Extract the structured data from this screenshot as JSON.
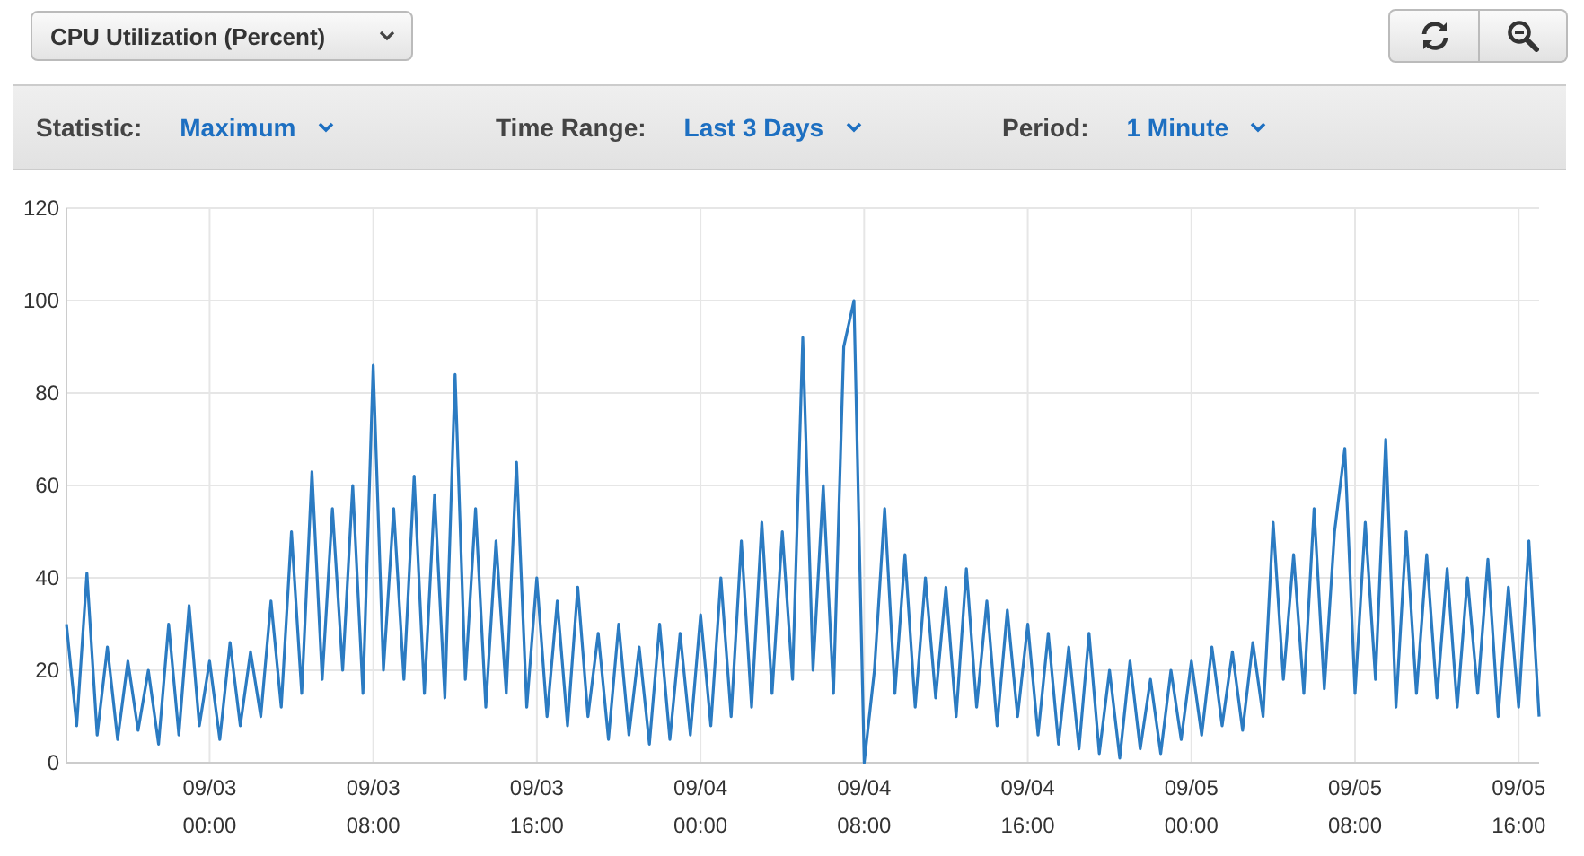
{
  "metric_select": {
    "value": "CPU Utilization (Percent)"
  },
  "toolbar": [
    {
      "label": "Statistic:",
      "value": "Maximum"
    },
    {
      "label": "Time Range:",
      "value": "Last 3 Days"
    },
    {
      "label": "Period:",
      "value": "1 Minute"
    }
  ],
  "chart": {
    "chart_data": {
      "type": "line",
      "grid": true,
      "ylim": [
        0,
        120
      ],
      "yticks": [
        0,
        20,
        40,
        60,
        80,
        100,
        120
      ],
      "categories": [
        null,
        null,
        null,
        null,
        null,
        null,
        null,
        null,
        null,
        null,
        null,
        null,
        null,
        null,
        "09/03 00:00",
        null,
        null,
        null,
        null,
        null,
        null,
        null,
        null,
        null,
        null,
        null,
        null,
        null,
        null,
        null,
        "09/03 08:00",
        null,
        null,
        null,
        null,
        null,
        null,
        null,
        null,
        null,
        null,
        null,
        null,
        null,
        null,
        null,
        "09/03 16:00",
        null,
        null,
        null,
        null,
        null,
        null,
        null,
        null,
        null,
        null,
        null,
        null,
        null,
        null,
        null,
        "09/04 00:00",
        null,
        null,
        null,
        null,
        null,
        null,
        null,
        null,
        null,
        null,
        null,
        null,
        null,
        null,
        null,
        "09/04 08:00",
        null,
        null,
        null,
        null,
        null,
        null,
        null,
        null,
        null,
        null,
        null,
        null,
        null,
        null,
        null,
        "09/04 16:00",
        null,
        null,
        null,
        null,
        null,
        null,
        null,
        null,
        null,
        null,
        null,
        null,
        null,
        null,
        null,
        "09/05 00:00",
        null,
        null,
        null,
        null,
        null,
        null,
        null,
        null,
        null,
        null,
        null,
        null,
        null,
        null,
        null,
        "09/05 08:00",
        null,
        null,
        null,
        null,
        null,
        null,
        null,
        null,
        null,
        null,
        null,
        null,
        null,
        null,
        null,
        "09/05 16:00",
        null,
        null
      ],
      "series": [
        {
          "color": "#2b7bc2",
          "values": [
            30,
            8,
            41,
            6,
            25,
            5,
            22,
            7,
            20,
            4,
            30,
            6,
            34,
            8,
            22,
            5,
            26,
            8,
            24,
            10,
            35,
            12,
            50,
            15,
            63,
            18,
            55,
            20,
            60,
            15,
            86,
            20,
            55,
            18,
            62,
            15,
            58,
            14,
            84,
            18,
            55,
            12,
            48,
            15,
            65,
            12,
            40,
            10,
            35,
            8,
            38,
            10,
            28,
            5,
            30,
            6,
            25,
            4,
            30,
            5,
            28,
            6,
            32,
            8,
            40,
            10,
            48,
            12,
            52,
            15,
            50,
            18,
            92,
            20,
            60,
            15,
            90,
            100,
            0,
            20,
            55,
            15,
            45,
            12,
            40,
            14,
            38,
            10,
            42,
            12,
            35,
            8,
            33,
            10,
            30,
            6,
            28,
            4,
            25,
            3,
            28,
            2,
            20,
            1,
            22,
            3,
            18,
            2,
            20,
            5,
            22,
            6,
            25,
            8,
            24,
            7,
            26,
            10,
            52,
            18,
            45,
            15,
            55,
            16,
            50,
            68,
            15,
            52,
            18,
            70,
            12,
            50,
            15,
            45,
            14,
            42,
            12,
            40,
            15,
            44,
            10,
            38,
            12,
            48,
            10
          ]
        }
      ]
    }
  }
}
